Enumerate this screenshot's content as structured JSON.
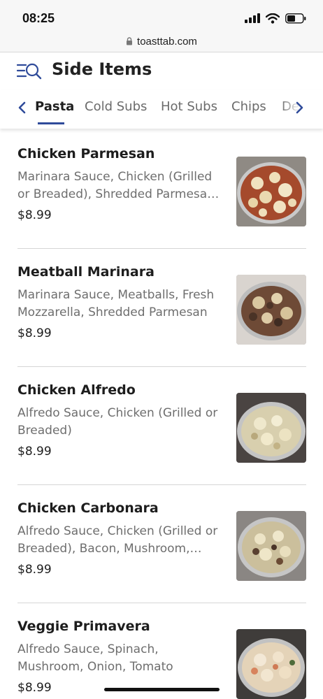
{
  "status_bar": {
    "time": "08:25",
    "icons": [
      "signal-icon",
      "wifi-icon",
      "battery-icon"
    ]
  },
  "browser": {
    "url": "toasttab.com",
    "lock_icon": "lock-icon"
  },
  "header": {
    "icon": "menu-search-icon",
    "title": "Side Items"
  },
  "tabs": {
    "prev_icon": "chevron-left-icon",
    "next_icon": "chevron-right-icon",
    "items": [
      {
        "label": "Pasta",
        "active": true
      },
      {
        "label": "Cold Subs",
        "active": false
      },
      {
        "label": "Hot Subs",
        "active": false
      },
      {
        "label": "Chips",
        "active": false
      },
      {
        "label": "De",
        "active": false
      }
    ]
  },
  "items": [
    {
      "name": "Chicken Parmesan",
      "desc_line1": "Marinara Sauce, Chicken (Grilled",
      "desc_line2": "or Breaded), Shredded Parmesa…",
      "price": "$8.99"
    },
    {
      "name": "Meatball Marinara",
      "desc_line1": "Marinara Sauce, Meatballs, Fresh",
      "desc_line2": "Mozzarella, Shredded Parmesan",
      "price": "$8.99"
    },
    {
      "name": "Chicken Alfredo",
      "desc_line1": "Alfredo Sauce, Chicken (Grilled or",
      "desc_line2": "Breaded)",
      "price": "$8.99"
    },
    {
      "name": "Chicken Carbonara",
      "desc_line1": "Alfredo Sauce, Chicken (Grilled or",
      "desc_line2": "Breaded), Bacon, Mushroom,…",
      "price": "$8.99"
    },
    {
      "name": "Veggie Primavera",
      "desc_line1": "Alfredo Sauce, Spinach,",
      "desc_line2": "Mushroom, Onion, Tomato",
      "price": "$8.99"
    }
  ],
  "colors": {
    "accent": "#2f4b9a",
    "text_primary": "#1d1d1d",
    "text_secondary": "#6e6e6e",
    "divider": "#d6d6d6"
  }
}
